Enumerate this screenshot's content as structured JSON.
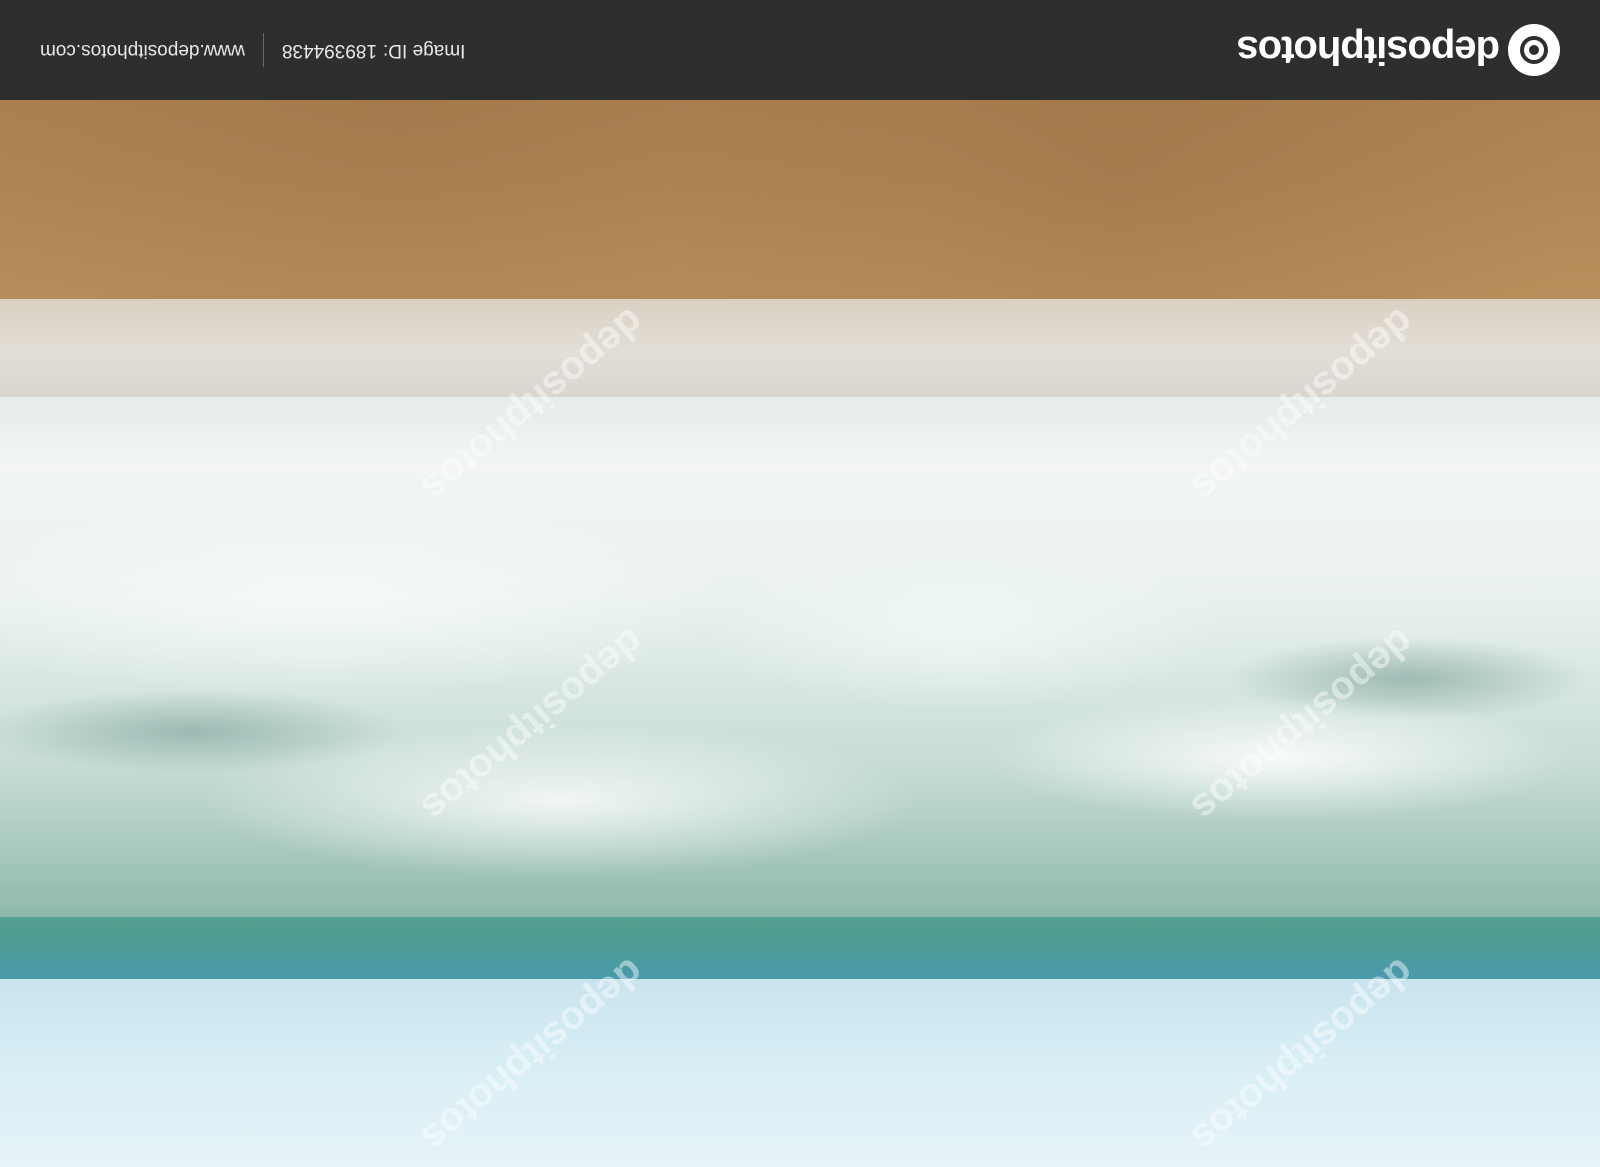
{
  "footer": {
    "brand": "depositphotos",
    "image_id_label": "Image ID:",
    "image_id": "189394438",
    "url": "www.depositphotos.com"
  },
  "watermark": {
    "text": "depositphotos"
  },
  "colors": {
    "bar": "#2e2e2e",
    "sand": "#b08656",
    "sea": "#4e9c8f",
    "sky": "#d8eef5"
  }
}
